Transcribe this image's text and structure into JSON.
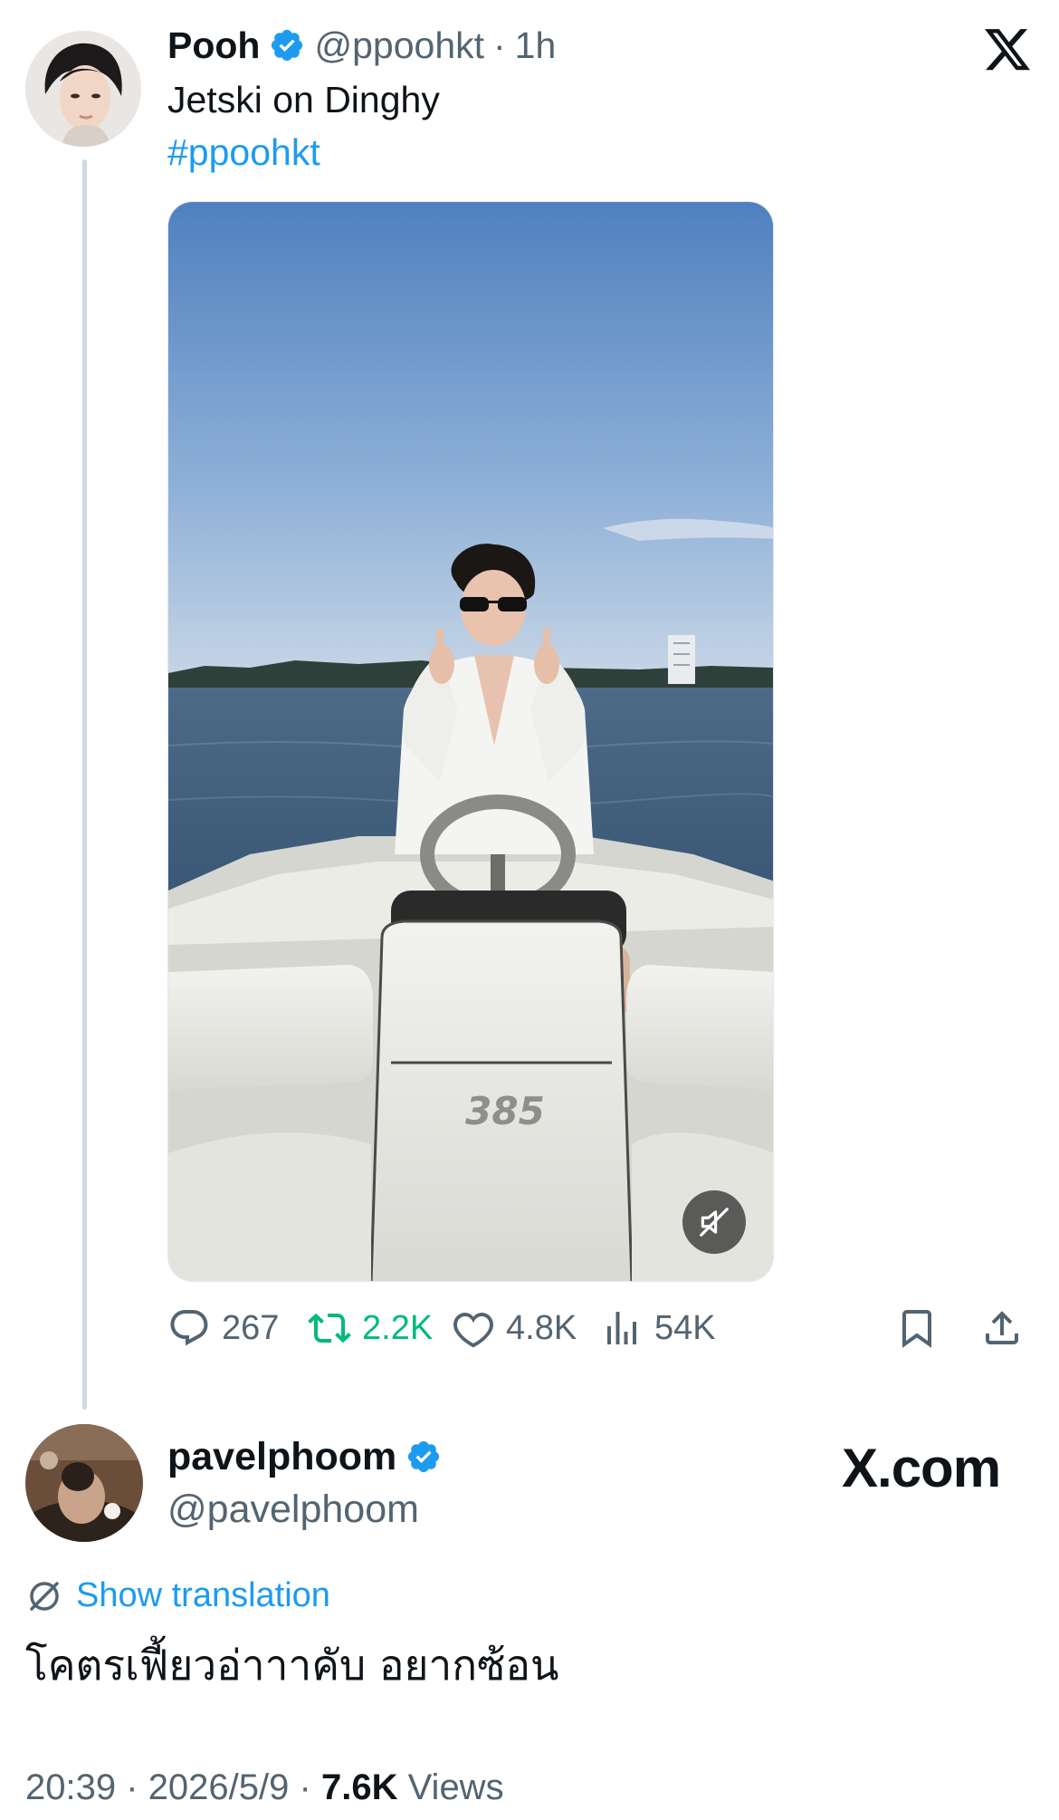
{
  "post": {
    "display_name": "Pooh",
    "handle": "@ppoohkt",
    "separator": "·",
    "time_ago": "1h",
    "text": "Jetski on Dinghy",
    "hashtag": "#ppoohkt",
    "avatar_icon": "profile-photo",
    "media": {
      "type": "video",
      "boat_label": "385",
      "mute_icon": "speaker-muted-icon"
    },
    "actions": {
      "replies": "267",
      "reposts": "2.2K",
      "likes": "4.8K",
      "views": "54K"
    },
    "verified": true
  },
  "reply": {
    "display_name": "pavelphoom",
    "handle": "@pavelphoom",
    "verified": true,
    "show_translation": "Show translation",
    "text": "โคตรเฟี้ยวอ่าาาคับ อยากซ้อน",
    "time": "20:39",
    "date": "2026/5/9",
    "views_count": "7.6K",
    "views_label": "Views",
    "separator": "·"
  },
  "watermark": {
    "text": "X.com"
  },
  "colors": {
    "accent": "#1d9bf0",
    "repost_active": "#00ba7c",
    "secondary_text": "#536471",
    "primary_text": "#0f1419"
  }
}
